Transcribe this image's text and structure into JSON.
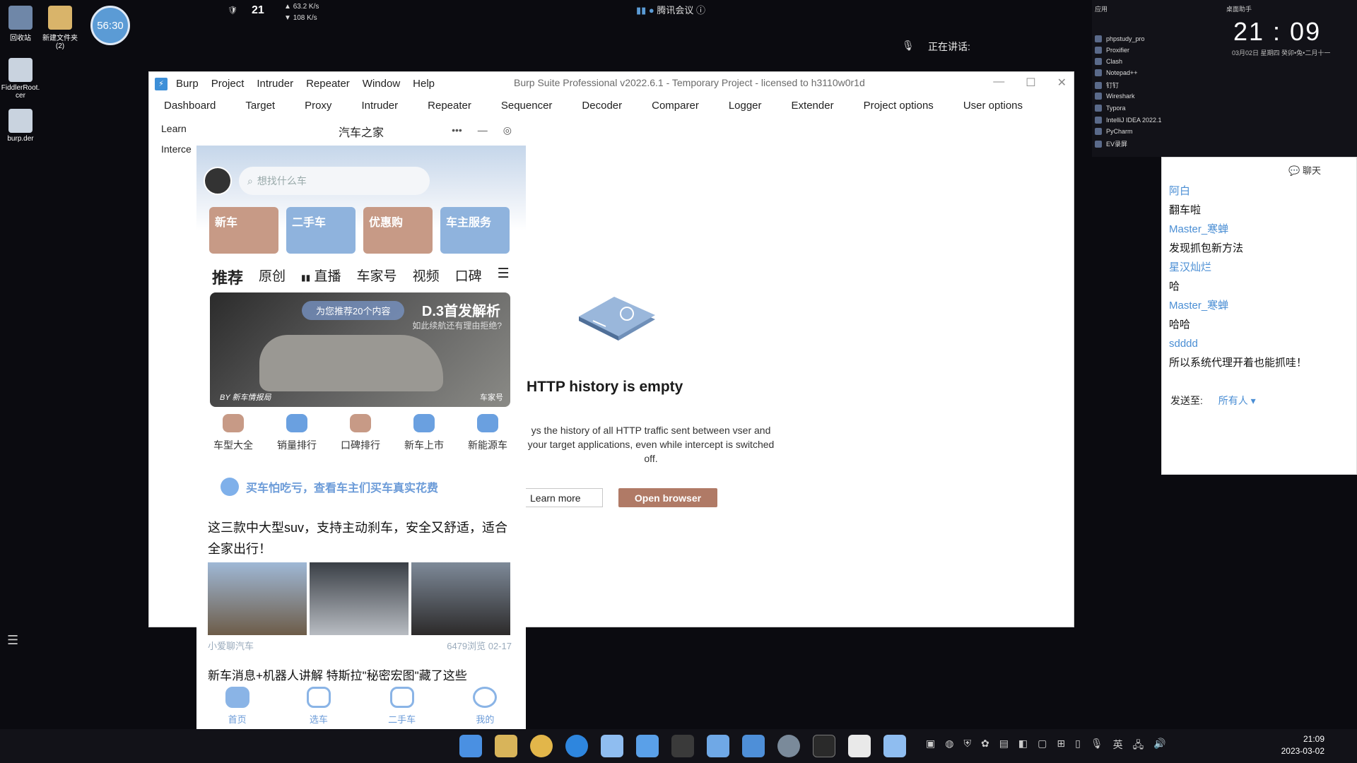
{
  "desktop": {
    "icons": [
      {
        "label": "回收站"
      },
      {
        "label": "新建文件夹\n(2)"
      },
      {
        "label": "FiddlerRoot.\ncer"
      },
      {
        "label": "burp.der"
      }
    ],
    "timer": "56:30",
    "net": {
      "temp": "21",
      "up": "63.2 K/s",
      "down": "108 K/s"
    },
    "meeting": "腾讯会议",
    "speaking": "正在讲话:"
  },
  "widget": {
    "section": "应用",
    "section2": "桌面助手",
    "apps": [
      "phpstudy_pro",
      "Proxifier",
      "Clash",
      "Notepad++",
      "钉钉",
      "Wireshark",
      "Typora",
      "IntelliJ IDEA 2022.1",
      "PyCharm",
      "EV录屏"
    ],
    "clock": "21 : 09",
    "date": "03月02日  星期四  癸卯•兔•二月十一"
  },
  "burp": {
    "menu": [
      "Burp",
      "Project",
      "Intruder",
      "Repeater",
      "Window",
      "Help"
    ],
    "title": "Burp Suite Professional v2022.6.1 - Temporary Project - licensed to h3110w0r1d",
    "tabs": [
      "Dashboard",
      "Target",
      "Proxy",
      "Intruder",
      "Repeater",
      "Sequencer",
      "Decoder",
      "Comparer",
      "Logger",
      "Extender",
      "Project options",
      "User options"
    ],
    "subtabs": [
      "Learn",
      "Interce"
    ],
    "empty_title": "HTTP history is empty",
    "empty_desc": "ys the history of all HTTP traffic sent between vser and your target applications, even while intercept is switched off.",
    "learn_more": "Learn more",
    "open_browser": "Open browser"
  },
  "chat": {
    "title": "聊天",
    "messages": [
      {
        "name": "阿白",
        "text": "翻车啦"
      },
      {
        "name": "Master_寒蝉",
        "text": "发现抓包新方法"
      },
      {
        "name": "星汉灿烂",
        "text": "哈"
      },
      {
        "name": "Master_寒蝉",
        "text": "哈哈"
      },
      {
        "name": "sdddd",
        "text": "所以系统代理开着也能抓哇！"
      }
    ],
    "send_to_label": "发送至:",
    "send_to_target": "所有人"
  },
  "phone": {
    "title": "汽车之家",
    "search_placeholder": "想找什么车",
    "categories": [
      {
        "label": "新车",
        "color": "#c79a86"
      },
      {
        "label": "二手车",
        "color": "#8fb3dd"
      },
      {
        "label": "优惠购",
        "color": "#c79a86"
      },
      {
        "label": "车主服务",
        "color": "#8fb3dd"
      }
    ],
    "feed_tabs": [
      "推荐",
      "原创",
      "直播",
      "车家号",
      "视频",
      "口碑"
    ],
    "banner": {
      "pill": "为您推荐20个内容",
      "headline": "D.3首发解析",
      "sub": "如此续航还有理由拒绝?",
      "by": "BY 新车情报局",
      "source": "车家号"
    },
    "quick_icons": [
      "车型大全",
      "销量排行",
      "口碑排行",
      "新车上市",
      "新能源车"
    ],
    "promo": "买车怕吃亏，查看车主们买车真实花费",
    "article_title": "这三款中大型suv，支持主动刹车，安全又舒适，适合全家出行！",
    "article_author": "小爱聊汽车",
    "article_stats": "6479浏览 02-17",
    "article2_title": "新车消息+机器人讲解 特斯拉\"秘密宏图\"藏了这些",
    "bottom_nav": [
      "首页",
      "选车",
      "二手车",
      "我的"
    ]
  },
  "taskbar": {
    "lang": "英",
    "time": "21:09",
    "date": "2023-03-02"
  }
}
